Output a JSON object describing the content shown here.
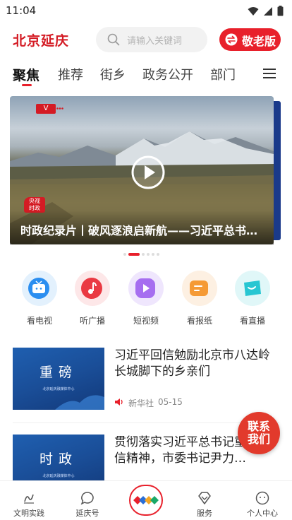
{
  "status_bar": {
    "time": "11:04"
  },
  "header": {
    "logo_text": "北京延庆",
    "search_placeholder": "请输入关键词",
    "elder_mode_label": "敬老版"
  },
  "tabs": [
    {
      "label": "聚焦",
      "active": true
    },
    {
      "label": "推荐",
      "active": false
    },
    {
      "label": "街乡",
      "active": false
    },
    {
      "label": "政务公开",
      "active": false
    },
    {
      "label": "部门",
      "active": false
    }
  ],
  "banner": {
    "title": "时政纪录片丨破风逐浪启新航——习近平总书记…",
    "badge_source": "央视频",
    "badge_source_line1": "央视",
    "badge_source_line2": "时政",
    "badge_mark": "V",
    "page_count": 6,
    "current_page": 1
  },
  "quick_links": [
    {
      "label": "看电视",
      "icon": "tv-icon",
      "color": "#2b8ef0",
      "bg": "#e3f1fd"
    },
    {
      "label": "听广播",
      "icon": "radio-icon",
      "color": "#ea3a43",
      "bg": "#fde7e8"
    },
    {
      "label": "短视频",
      "icon": "short-video-icon",
      "color": "#a66ef0",
      "bg": "#efe6fd"
    },
    {
      "label": "看报纸",
      "icon": "newspaper-icon",
      "color": "#f59a35",
      "bg": "#fdf0e2"
    },
    {
      "label": "看直播",
      "icon": "live-icon",
      "color": "#27c6d2",
      "bg": "#e0f7f8"
    }
  ],
  "news": [
    {
      "thumb_title": "重磅",
      "thumb_sub": "北京延庆融媒体中心",
      "title": "习近平回信勉励北京市八达岭长城脚下的乡亲们",
      "source": "新华社",
      "date": "05-15"
    },
    {
      "thumb_title": "时政",
      "thumb_sub": "北京延庆融媒体中心",
      "title": "贯彻落实习近平总书记重要回信精神，市委书记尹力…",
      "source": "",
      "date": ""
    }
  ],
  "contact_button": {
    "line1": "联系",
    "line2": "我们"
  },
  "bottom_nav": [
    {
      "label": "文明实践",
      "icon": "civilization-icon"
    },
    {
      "label": "延庆号",
      "icon": "chat-bubble-icon"
    },
    {
      "label": "",
      "icon": "home-logo-icon"
    },
    {
      "label": "服务",
      "icon": "diamond-service-icon"
    },
    {
      "label": "个人中心",
      "icon": "user-center-icon"
    }
  ],
  "colors": {
    "brand_red": "#e8202b",
    "text_dark": "#222222",
    "text_gray": "#888888"
  }
}
